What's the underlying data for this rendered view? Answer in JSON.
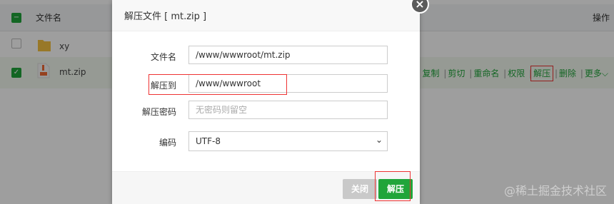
{
  "file_manager": {
    "header": {
      "name_col": "文件名",
      "ops_col": "操作"
    },
    "rows": [
      {
        "name": "xy",
        "type": "folder"
      },
      {
        "name": "mt.zip",
        "type": "zip",
        "ops": [
          "复制",
          "剪切",
          "重命名",
          "权限",
          "解压",
          "删除",
          "更多"
        ]
      }
    ],
    "more_icon": "chevron-down-icon"
  },
  "dialog": {
    "title": "解压文件 [ mt.zip ]",
    "close_icon": "close-icon",
    "fields": {
      "filename_label": "文件名",
      "filename_value": "/www/wwwroot/mt.zip",
      "dest_label": "解压到",
      "dest_value": "/www/wwwroot",
      "password_label": "解压密码",
      "password_placeholder": "无密码则留空",
      "encoding_label": "编码",
      "encoding_value": "UTF-8"
    },
    "buttons": {
      "close": "关闭",
      "extract": "解压"
    }
  },
  "watermark": "@稀土掘金技术社区",
  "colors": {
    "accent": "#20a53a",
    "highlight": "#e33333"
  }
}
